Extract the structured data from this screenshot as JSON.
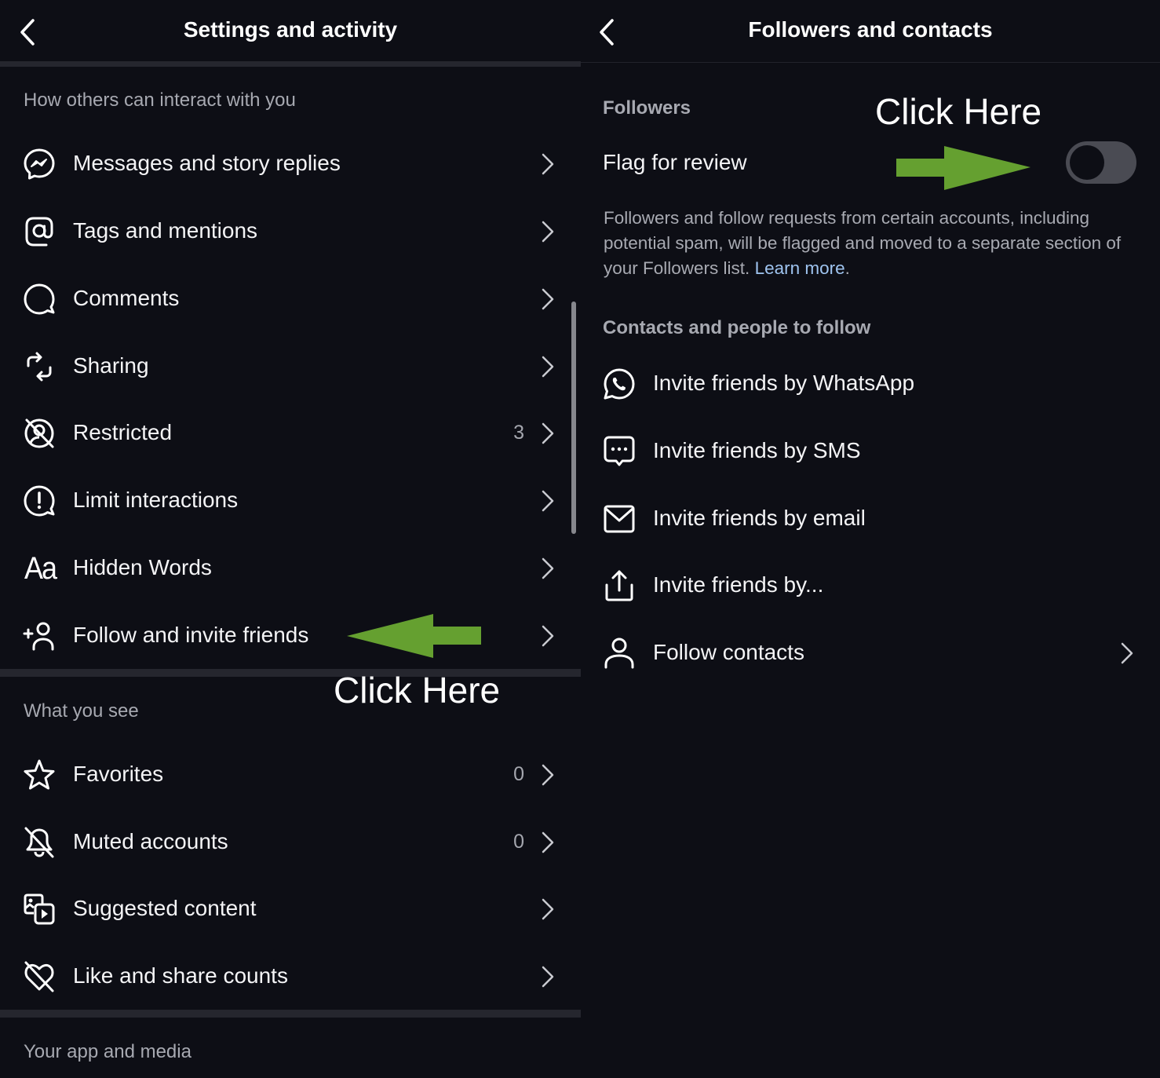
{
  "left_panel": {
    "title": "Settings and activity",
    "back_icon": "chevron-left-icon",
    "sections": [
      {
        "header": "How others can interact with you",
        "items": [
          {
            "label": "Messages and story replies",
            "icon": "messenger-icon",
            "count": ""
          },
          {
            "label": "Tags and mentions",
            "icon": "at-sign-icon",
            "count": ""
          },
          {
            "label": "Comments",
            "icon": "comment-bubble-icon",
            "count": ""
          },
          {
            "label": "Sharing",
            "icon": "repost-icon",
            "count": ""
          },
          {
            "label": "Restricted",
            "icon": "restricted-icon",
            "count": "3"
          },
          {
            "label": "Limit interactions",
            "icon": "alert-bubble-icon",
            "count": ""
          },
          {
            "label": "Hidden Words",
            "icon": "text-aa-icon",
            "count": ""
          },
          {
            "label": "Follow and invite friends",
            "icon": "add-person-icon",
            "count": ""
          }
        ]
      },
      {
        "header": "What you see",
        "items": [
          {
            "label": "Favorites",
            "icon": "star-icon",
            "count": "0"
          },
          {
            "label": "Muted accounts",
            "icon": "bell-off-icon",
            "count": "0"
          },
          {
            "label": "Suggested content",
            "icon": "media-play-icon",
            "count": ""
          },
          {
            "label": "Like and share counts",
            "icon": "heart-off-icon",
            "count": ""
          }
        ]
      },
      {
        "header": "Your app and media",
        "items": []
      }
    ],
    "glyphs": {
      "aa": "Aa",
      "plus": "+"
    },
    "annotation": {
      "text": "Click Here",
      "arrow_color": "#65a030",
      "arrow_direction": "left"
    }
  },
  "right_panel": {
    "title": "Followers and contacts",
    "back_icon": "chevron-left-icon",
    "followers": {
      "header": "Followers",
      "flag_label": "Flag for review",
      "toggle_on": false,
      "description": "Followers and follow requests from certain accounts, including potential spam, will be flagged and moved to a separate section of your Followers list.",
      "learn_more": "Learn more",
      "period": "."
    },
    "contacts": {
      "header": "Contacts and people to follow",
      "items": [
        {
          "label": "Invite friends by WhatsApp",
          "icon": "whatsapp-icon",
          "chevron": false
        },
        {
          "label": "Invite friends by SMS",
          "icon": "sms-bubble-icon",
          "chevron": false
        },
        {
          "label": "Invite friends by email",
          "icon": "mail-icon",
          "chevron": false
        },
        {
          "label": "Invite friends by...",
          "icon": "share-upload-icon",
          "chevron": false
        },
        {
          "label": "Follow contacts",
          "icon": "person-icon",
          "chevron": true
        }
      ]
    },
    "annotation": {
      "text": "Click Here",
      "arrow_color": "#65a030",
      "arrow_direction": "right"
    }
  },
  "colors": {
    "background": "#0d0e15",
    "text": "#f4f4f6",
    "muted_text": "#a7a9b1",
    "link": "#9fc4f0",
    "divider": "#25262e",
    "toggle_off": "#4a4b53",
    "annotation_arrow": "#65a030"
  }
}
